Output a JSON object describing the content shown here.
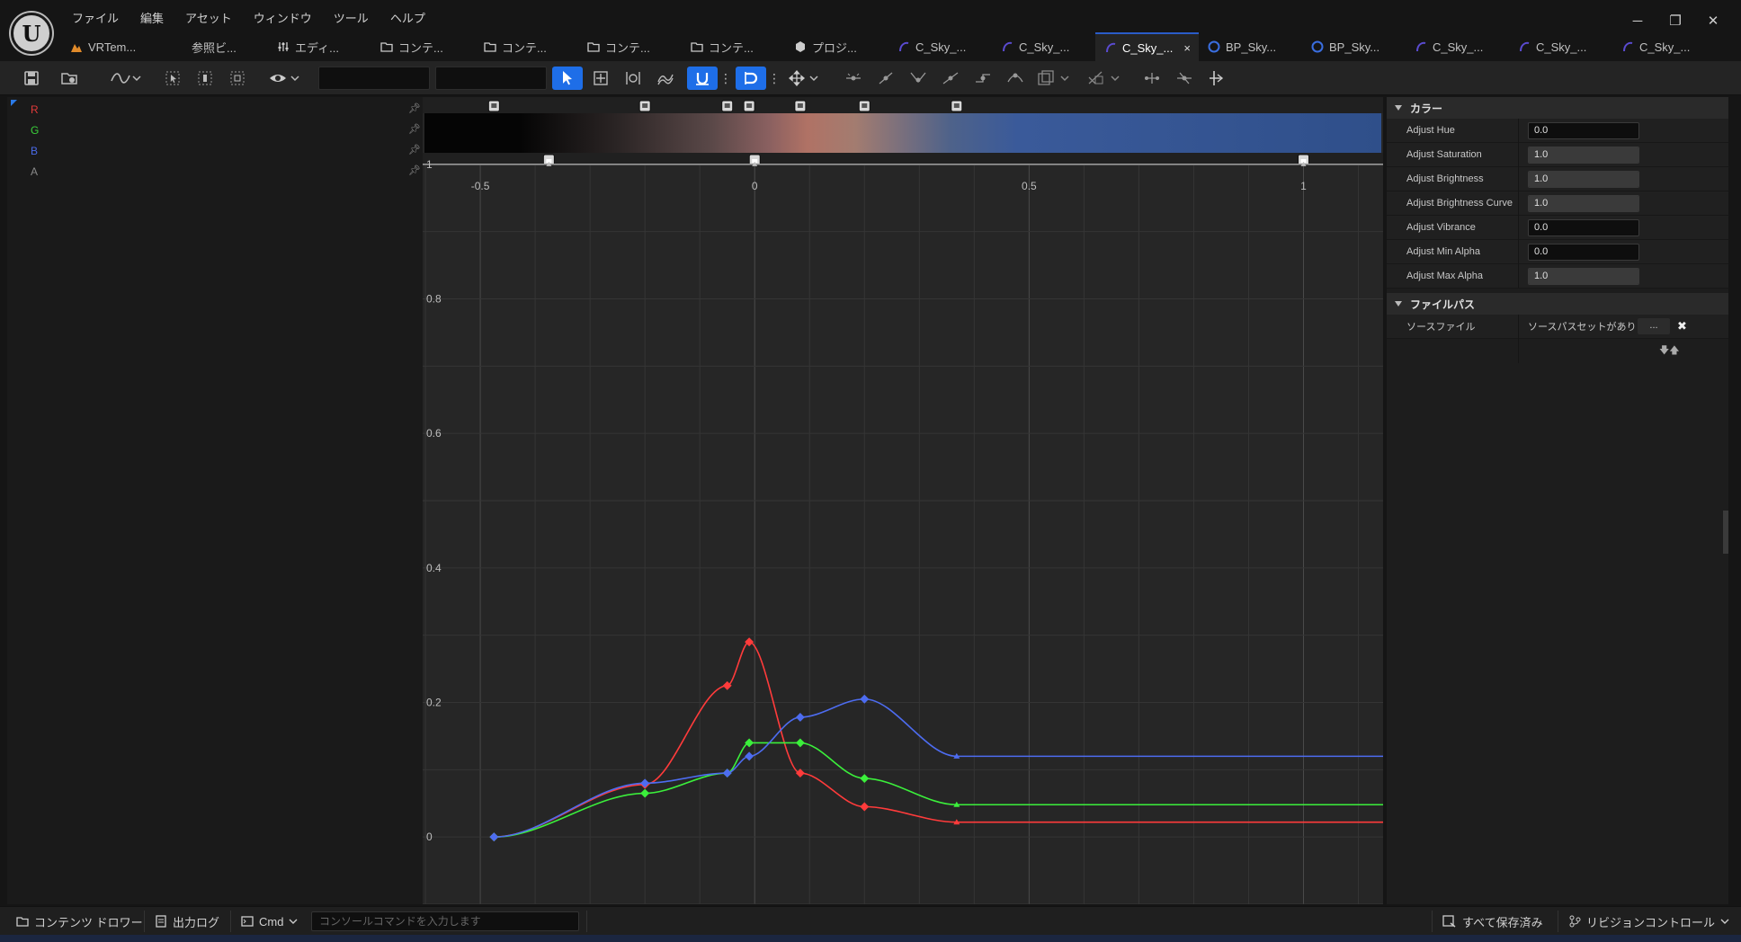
{
  "menu": [
    "ファイル",
    "編集",
    "アセット",
    "ウィンドウ",
    "ツール",
    "ヘルプ"
  ],
  "tabs": [
    {
      "label": "VRTem...",
      "icon": "level-icon",
      "color": "#e08a2a"
    },
    {
      "label": "参照ビ...",
      "icon": "reference-viewer-icon",
      "color": "#888888"
    },
    {
      "label": "エディ...",
      "icon": "editor-settings-icon",
      "color": "#cccccc"
    },
    {
      "label": "コンテ...",
      "icon": "content-browser-icon",
      "color": "#cccccc"
    },
    {
      "label": "コンテ...",
      "icon": "content-browser-icon",
      "color": "#cccccc"
    },
    {
      "label": "コンテ...",
      "icon": "content-browser-icon",
      "color": "#cccccc"
    },
    {
      "label": "コンテ...",
      "icon": "content-browser-icon",
      "color": "#cccccc"
    },
    {
      "label": "プロジ...",
      "icon": "project-settings-icon",
      "color": "#cccccc"
    },
    {
      "label": "C_Sky_...",
      "icon": "curve-icon",
      "color": "#5a4bd0"
    },
    {
      "label": "C_Sky_...",
      "icon": "curve-icon",
      "color": "#5a4bd0"
    },
    {
      "label": "C_Sky_...",
      "icon": "curve-icon",
      "color": "#5a4bd0",
      "active": true
    },
    {
      "label": "BP_Sky...",
      "icon": "blueprint-icon",
      "color": "#3a6ee0"
    },
    {
      "label": "BP_Sky...",
      "icon": "blueprint-icon",
      "color": "#3a6ee0"
    },
    {
      "label": "C_Sky_...",
      "icon": "curve-icon",
      "color": "#5a4bd0"
    },
    {
      "label": "C_Sky_...",
      "icon": "curve-icon",
      "color": "#5a4bd0"
    },
    {
      "label": "C_Sky_...",
      "icon": "curve-icon",
      "color": "#5a4bd0"
    }
  ],
  "tab_close": "×",
  "window_controls": [
    "─",
    "❐",
    "✕"
  ],
  "channels": [
    {
      "label": "R",
      "color": "#e03a3a"
    },
    {
      "label": "G",
      "color": "#3ad03a"
    },
    {
      "label": "B",
      "color": "#4a6ae8"
    },
    {
      "label": "A",
      "color": "#8a8a8a"
    }
  ],
  "chart_data": {
    "type": "line",
    "x_ticks": [
      -0.5,
      0,
      0.5,
      1
    ],
    "y_ticks": [
      0,
      0.2,
      0.4,
      0.6,
      0.8,
      1
    ],
    "xlim": [
      -0.605,
      1.145
    ],
    "ylim": [
      -0.1,
      1.1
    ],
    "series": [
      {
        "name": "R",
        "color": "#ff3b3b",
        "points": [
          [
            -0.475,
            0
          ],
          [
            -0.2,
            0.078
          ],
          [
            -0.05,
            0.225
          ],
          [
            -0.01,
            0.29
          ],
          [
            0.083,
            0.095
          ],
          [
            0.2,
            0.045
          ],
          [
            0.368,
            0.022
          ],
          [
            1.145,
            0.022
          ]
        ]
      },
      {
        "name": "G",
        "color": "#3bef3b",
        "points": [
          [
            -0.475,
            0
          ],
          [
            -0.2,
            0.065
          ],
          [
            -0.05,
            0.095
          ],
          [
            -0.01,
            0.14
          ],
          [
            0.083,
            0.14
          ],
          [
            0.2,
            0.087
          ],
          [
            0.368,
            0.048
          ],
          [
            1.145,
            0.048
          ]
        ]
      },
      {
        "name": "B",
        "color": "#4d6cf0",
        "points": [
          [
            -0.475,
            0
          ],
          [
            -0.2,
            0.08
          ],
          [
            -0.05,
            0.095
          ],
          [
            -0.01,
            0.12
          ],
          [
            0.083,
            0.178
          ],
          [
            0.2,
            0.205
          ],
          [
            0.368,
            0.12
          ],
          [
            1.145,
            0.12
          ]
        ]
      },
      {
        "name": "A",
        "color": "#9a9a9a",
        "points": [
          [
            -0.605,
            1
          ],
          [
            1.145,
            1
          ]
        ]
      }
    ],
    "alpha_keys": [
      -0.375,
      0,
      1
    ],
    "color_keys": [
      -0.475,
      -0.2,
      -0.05,
      -0.01,
      0.083,
      0.2,
      0.368
    ],
    "gradient_stops": [
      {
        "pos": 0.0,
        "color": "#050505"
      },
      {
        "pos": 0.1,
        "color": "#050505"
      },
      {
        "pos": 0.2,
        "color": "#2a2424"
      },
      {
        "pos": 0.3,
        "color": "#5a4848"
      },
      {
        "pos": 0.36,
        "color": "#8a6060"
      },
      {
        "pos": 0.4,
        "color": "#b07265"
      },
      {
        "pos": 0.45,
        "color": "#a37c70"
      },
      {
        "pos": 0.55,
        "color": "#4e628a"
      },
      {
        "pos": 0.62,
        "color": "#3a5a9a"
      },
      {
        "pos": 1.0,
        "color": "#2f4f8a"
      }
    ],
    "grid": true
  },
  "details": {
    "color_section": "カラー",
    "file_section": "ファイルパス",
    "properties": [
      {
        "label": "Adjust Hue",
        "value": "0.0",
        "fill": 0
      },
      {
        "label": "Adjust Saturation",
        "value": "1.0",
        "fill": 1
      },
      {
        "label": "Adjust Brightness",
        "value": "1.0",
        "fill": 1
      },
      {
        "label": "Adjust Brightness Curve",
        "value": "1.0",
        "fill": 1
      },
      {
        "label": "Adjust Vibrance",
        "value": "0.0",
        "fill": 0
      },
      {
        "label": "Adjust Min Alpha",
        "value": "0.0",
        "fill": 0
      },
      {
        "label": "Adjust Max Alpha",
        "value": "1.0",
        "fill": 1
      }
    ],
    "source_file_label": "ソースファイル",
    "source_file_value": "ソースパスセットがありま",
    "browse_label": "...",
    "clear_label": "✖",
    "arrows": "🡇🡅"
  },
  "status": {
    "content_drawer": "コンテンツ ドロワー",
    "output_log": "出力ログ",
    "cmd": "Cmd",
    "cmd_placeholder": "コンソールコマンドを入力します",
    "save_all": "すべて保存済み",
    "revision_control": "リビジョンコントロール"
  }
}
